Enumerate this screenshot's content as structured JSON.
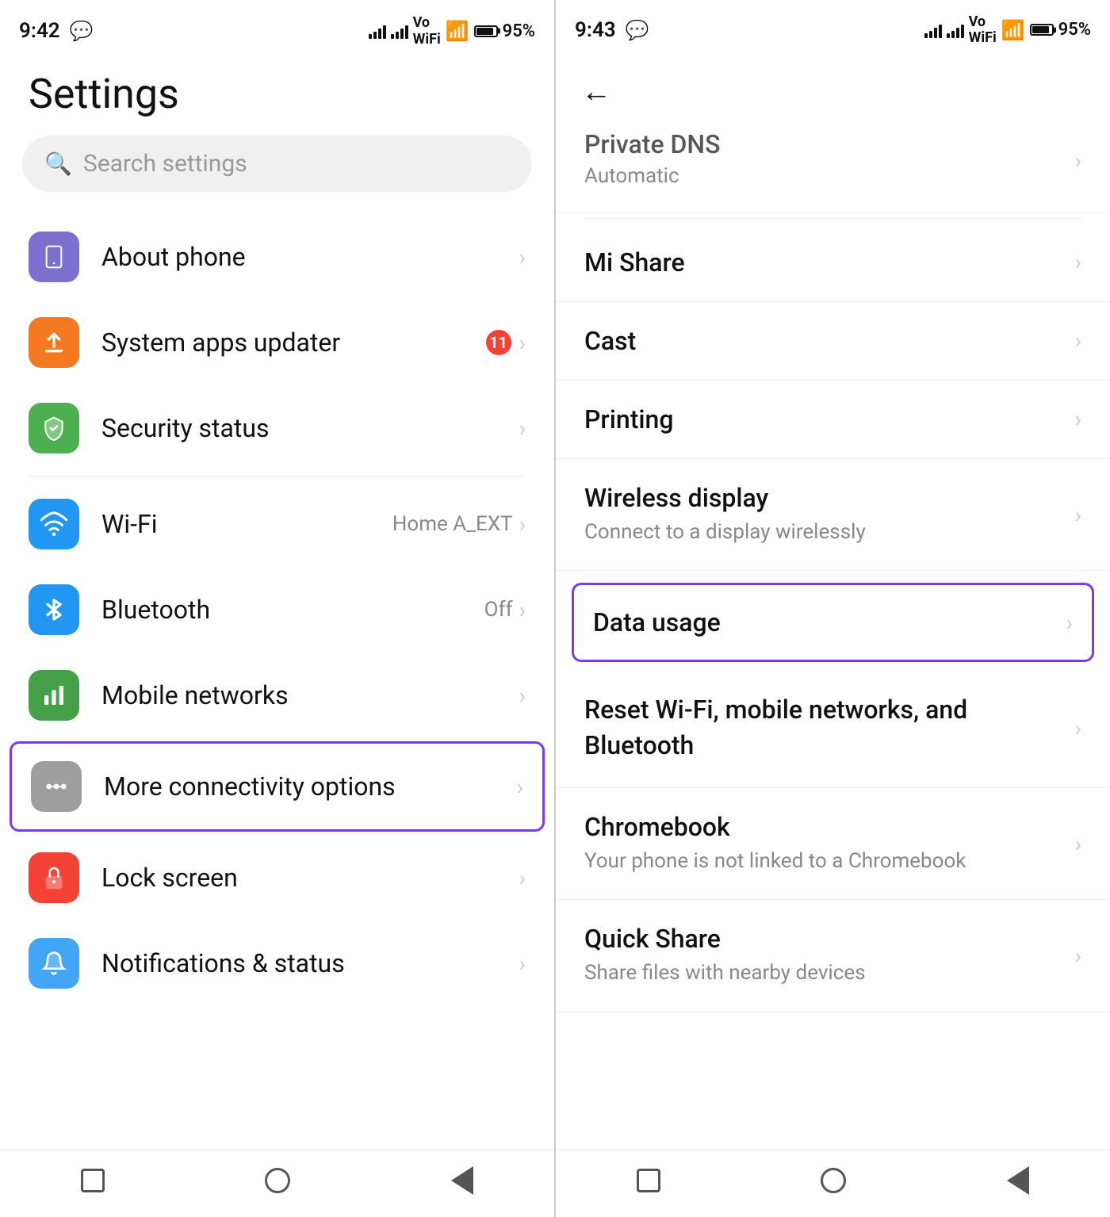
{
  "left": {
    "status": {
      "time": "9:42",
      "whatsapp": "💬",
      "battery": "95%"
    },
    "title": "Settings",
    "search": {
      "placeholder": "Search settings"
    },
    "items": [
      {
        "id": "about-phone",
        "icon": "phone",
        "iconClass": "icon-purple",
        "label": "About phone",
        "meta": "",
        "chevron": "›"
      },
      {
        "id": "system-apps",
        "icon": "↑",
        "iconClass": "icon-orange",
        "label": "System apps updater",
        "badge": "11",
        "chevron": "›"
      },
      {
        "id": "security-status",
        "icon": "✓",
        "iconClass": "icon-green",
        "label": "Security status",
        "chevron": "›"
      },
      {
        "id": "wifi",
        "icon": "wifi",
        "iconClass": "icon-blue",
        "label": "Wi-Fi",
        "meta": "Home A_EXT",
        "chevron": "›"
      },
      {
        "id": "bluetooth",
        "icon": "bt",
        "iconClass": "icon-blue",
        "label": "Bluetooth",
        "meta": "Off",
        "chevron": "›"
      },
      {
        "id": "mobile-networks",
        "icon": "net",
        "iconClass": "icon-green-dark",
        "label": "Mobile networks",
        "chevron": "›"
      },
      {
        "id": "more-connectivity",
        "icon": "link",
        "iconClass": "icon-gray",
        "label": "More connectivity options",
        "chevron": "›",
        "highlighted": true
      },
      {
        "id": "lock-screen",
        "icon": "🔒",
        "iconClass": "icon-red",
        "label": "Lock screen",
        "chevron": "›"
      },
      {
        "id": "notifications",
        "icon": "notif",
        "iconClass": "icon-blue-light",
        "label": "Notifications & status",
        "chevron": "›"
      }
    ],
    "nav": {
      "square": "■",
      "circle": "●",
      "triangle": "◄"
    }
  },
  "right": {
    "status": {
      "time": "9:43",
      "battery": "95%"
    },
    "partial_item": {
      "title": "Private DNS",
      "subtitle": "Automatic"
    },
    "items": [
      {
        "id": "mi-share",
        "label": "Mi Share",
        "chevron": "›"
      },
      {
        "id": "cast",
        "label": "Cast",
        "chevron": "›"
      },
      {
        "id": "printing",
        "label": "Printing",
        "chevron": "›"
      },
      {
        "id": "wireless-display",
        "label": "Wireless display",
        "subtitle": "Connect to a display wirelessly",
        "chevron": "›"
      },
      {
        "id": "data-usage",
        "label": "Data usage",
        "chevron": "›",
        "highlighted": true
      },
      {
        "id": "reset-wifi",
        "label": "Reset Wi-Fi, mobile networks, and Bluetooth",
        "chevron": "›"
      },
      {
        "id": "chromebook",
        "label": "Chromebook",
        "subtitle": "Your phone is not linked to a Chromebook",
        "chevron": "›"
      },
      {
        "id": "quick-share",
        "label": "Quick Share",
        "subtitle": "Share files with nearby devices",
        "chevron": "›"
      }
    ]
  }
}
